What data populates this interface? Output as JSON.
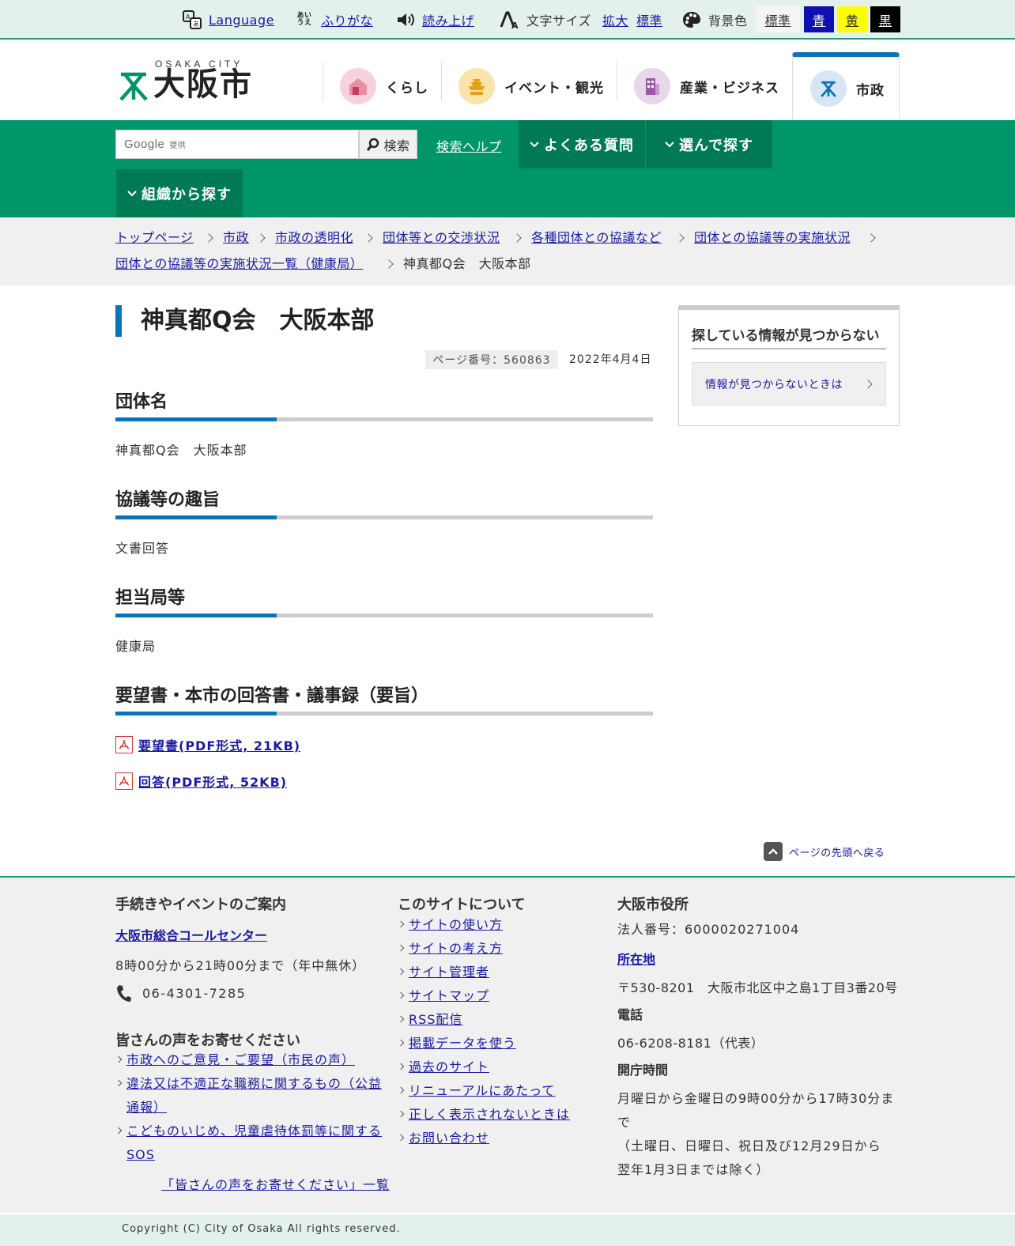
{
  "utility": {
    "language": "Language",
    "furigana": "ふりがな",
    "read_aloud": "読み上げ",
    "font_size_label": "文字サイズ",
    "font_size_large": "拡大",
    "font_size_normal": "標準",
    "bg_color_label": "背景色",
    "bg_options": [
      "標準",
      "青",
      "黄",
      "黒"
    ]
  },
  "header": {
    "logo_small": "OSAKA CITY",
    "logo_main": "大阪市",
    "nav": [
      "くらし",
      "イベント・観光",
      "産業・ビジネス",
      "市政"
    ]
  },
  "searchbar": {
    "google": "Google",
    "provided": "提供",
    "button": "検索",
    "help": "検索ヘルプ",
    "faq": "よくある質問",
    "choose": "選んで探す",
    "org": "組織から探す"
  },
  "breadcrumb": [
    "トップページ",
    "市政",
    "市政の透明化",
    "団体等との交渉状況",
    "各種団体との協議など",
    "団体との協議等の実施状況",
    "団体との協議等の実施状況一覧（健康局）",
    "神真都Q会　大阪本部"
  ],
  "page": {
    "title": "神真都Q会　大阪本部",
    "page_number": "ページ番号：560863",
    "date": "2022年4月4日",
    "sections": [
      {
        "heading": "団体名",
        "body": "神真都Q会　大阪本部"
      },
      {
        "heading": "協議等の趣旨",
        "body": "文書回答"
      },
      {
        "heading": "担当局等",
        "body": "健康局"
      },
      {
        "heading": "要望書・本市の回答書・議事録（要旨）",
        "body": ""
      }
    ],
    "attachments": [
      "要望書(PDF形式, 21KB)",
      "回答(PDF形式, 52KB)"
    ],
    "back_to_top": "ページの先頭へ戻る"
  },
  "sidebar": {
    "title": "探している情報が見つからない",
    "link": "情報が見つからないときは"
  },
  "footer": {
    "col1": {
      "heading": "手続きやイベントのご案内",
      "call_center": "大阪市総合コールセンター",
      "hours": "8時00分から21時00分まで（年中無休）",
      "phone": "06-4301-7285",
      "voice_heading": "皆さんの声をお寄せください",
      "voice_links": [
        "市政へのご意見・ご要望（市民の声）",
        "違法又は不適正な職務に関するもの（公益",
        "通報）",
        "こどものいじめ、児童虐待体罰等に関する",
        "SOS"
      ],
      "voice_all": "「皆さんの声をお寄せください」一覧"
    },
    "col2": {
      "heading": "このサイトについて",
      "links": [
        "サイトの使い方",
        "サイトの考え方",
        "サイト管理者",
        "サイトマップ",
        "RSS配信",
        "掲載データを使う",
        "過去のサイト",
        "リニューアルにあたって",
        "正しく表示されないときは",
        "お問い合わせ"
      ]
    },
    "col3": {
      "heading": "大阪市役所",
      "corp_no": "法人番号：6000020271004",
      "location_label": "所在地",
      "address": "〒530-8201　大阪市北区中之島1丁目3番20号",
      "phone_label": "電話",
      "phone": "06-6208-8181（代表）",
      "hours_label": "開庁時間",
      "hours_lines": [
        "月曜日から金曜日の9時00分から17時30分ま",
        "で",
        "（土曜日、日曜日、祝日及び12月29日から",
        "翌年1月3日までは除く）"
      ]
    },
    "copyright": "Copyright (C) City of Osaka All rights reserved."
  },
  "colors": {
    "brand_green": "#009669",
    "dark_green": "#007a55",
    "accent_blue": "#0b73b8",
    "link": "#1a1aa6"
  }
}
